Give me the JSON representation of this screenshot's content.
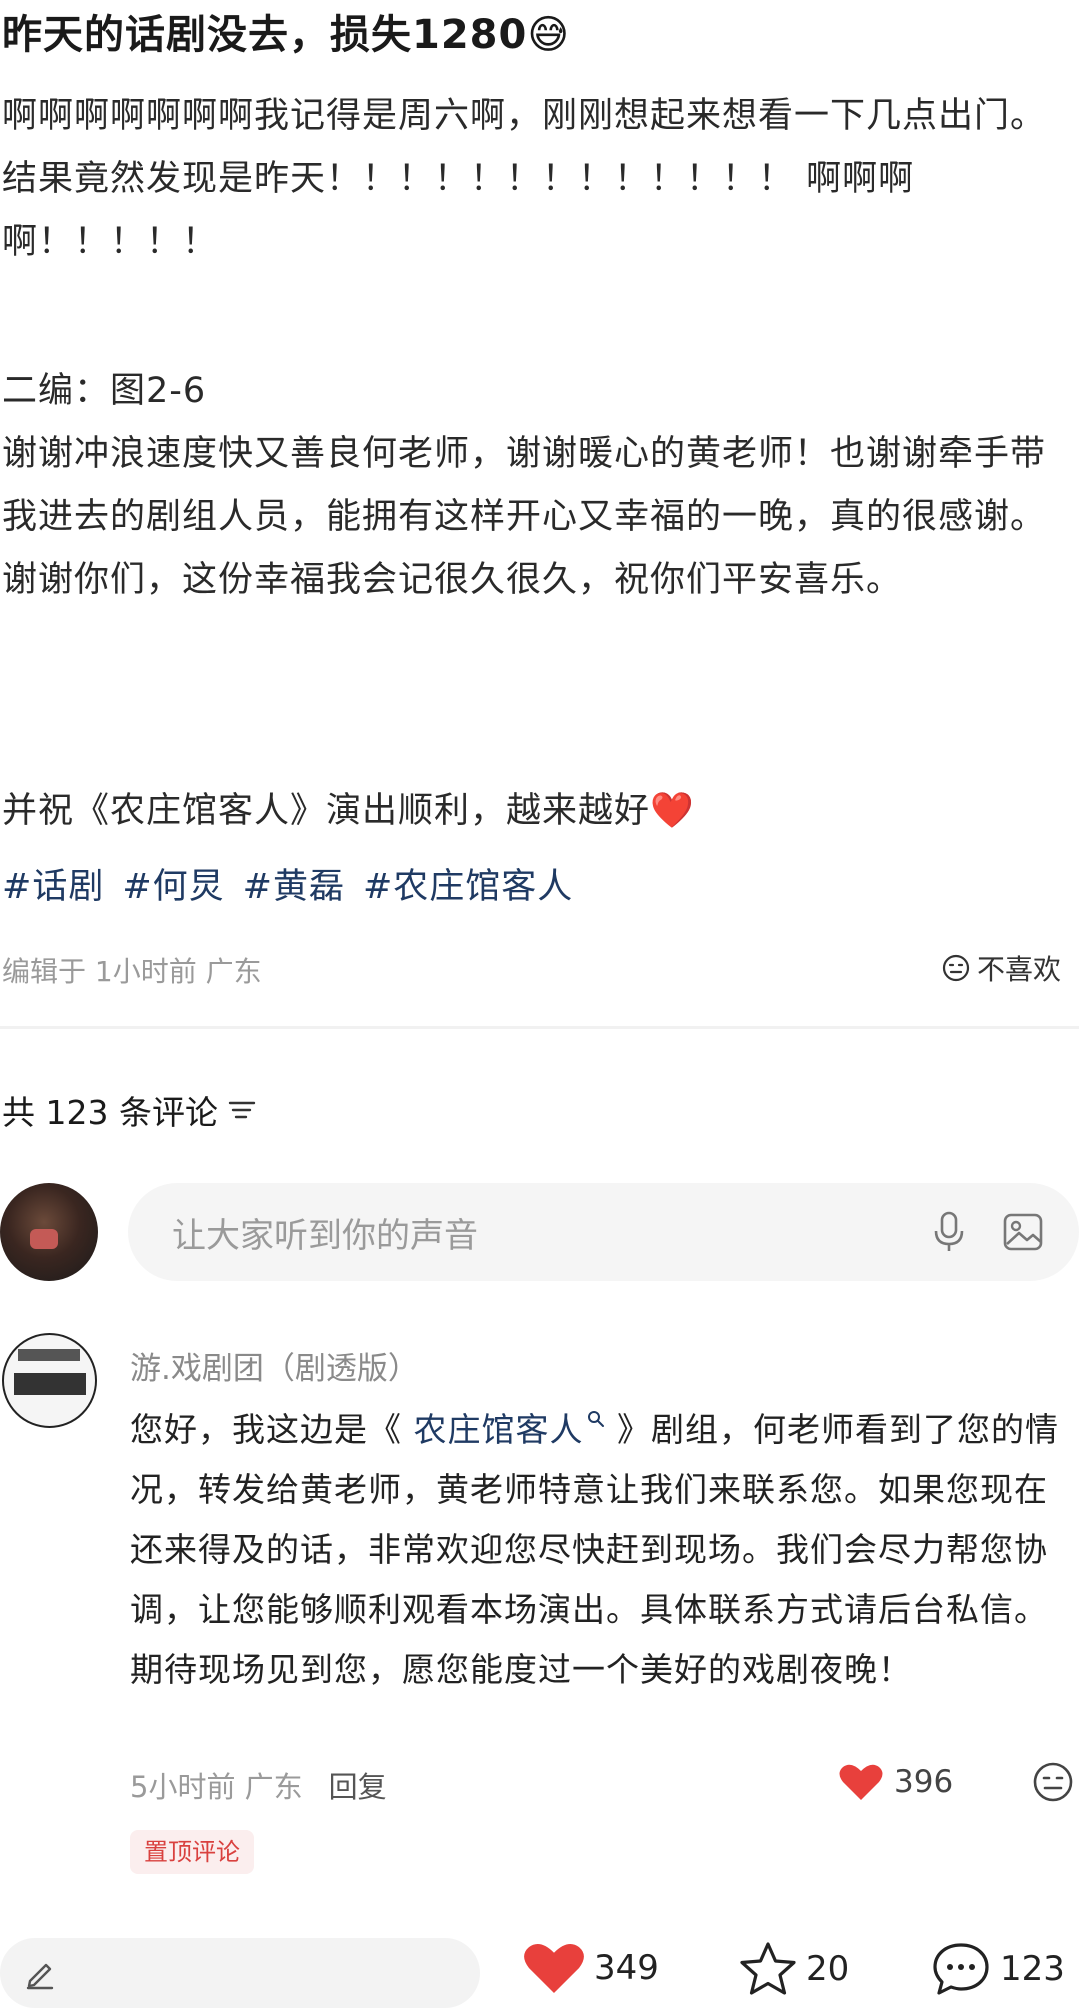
{
  "post": {
    "title": "昨天的话剧没去，损失1280😅",
    "para1": "啊啊啊啊啊啊啊我记得是周六啊，刚刚想起来想看一下几点出门。结果竟然发现是昨天！！！！！！！！！！！！！ 啊啊啊啊！！！！！",
    "para2": "二编：图2-6",
    "para3": "谢谢冲浪速度快又善良何老师，谢谢暖心的黄老师！也谢谢牵手带我进去的剧组人员，能拥有这样开心又幸福的一晚，真的很感谢。谢谢你们，这份幸福我会记很久很久，祝你们平安喜乐。",
    "para4": "并祝《农庄馆客人》演出顺利，越来越好❤️",
    "tags": [
      "#话剧",
      "#何炅",
      "#黄磊",
      "#农庄馆客人"
    ],
    "meta": "编辑于 1小时前 广东",
    "dislike_label": "不喜欢"
  },
  "comments_header": {
    "count_label": "共 123 条评论"
  },
  "comment_input": {
    "placeholder": "让大家听到你的声音"
  },
  "comment": {
    "author": "游.戏剧团（剧透版）",
    "body_prefix": "您好，我这边是《",
    "body_link": " 农庄馆客人",
    "body_suffix": " 》剧组，何老师看到了您的情况，转发给黄老师，黄老师特意让我们来联系您。如果您现在还来得及的话，非常欢迎您尽快赶到现场。我们会尽力帮您协调，让您能够顺利观看本场演出。具体联系方式请后台私信。期待现场见到您，愿您能度过一个美好的戏剧夜晚！",
    "time": "5小时前 广东",
    "reply_label": "回复",
    "likes": "396",
    "pinned_label": "置顶评论"
  },
  "bottom_bar": {
    "input_text": "",
    "likes": "349",
    "stars": "20",
    "comments": "123"
  },
  "colors": {
    "accent_red": "#e8403c",
    "tag_blue": "#1f3a63",
    "muted_gray": "#9a9a9a"
  }
}
